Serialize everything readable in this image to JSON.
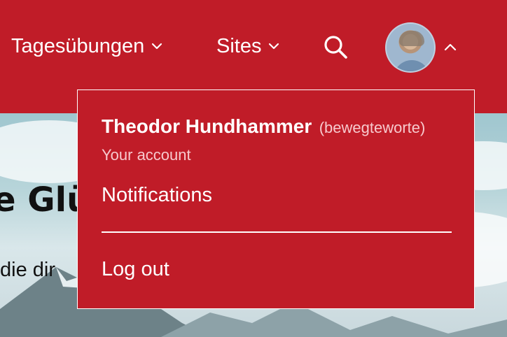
{
  "nav": {
    "items": [
      {
        "label": "Tagesübungen",
        "icon": "chevron-down-icon"
      },
      {
        "label": "Sites",
        "icon": "chevron-down-icon"
      }
    ],
    "search_icon": "search-icon",
    "avatar_toggle_icon": "chevron-up-icon"
  },
  "dropdown": {
    "user_name": "Theodor Hundhammer",
    "user_handle": "(bewegteworte)",
    "account_label": "Your account",
    "notifications_label": "Notifications",
    "logout_label": "Log out"
  },
  "background": {
    "heading_fragment": "e Glü",
    "text_fragment": "die dir"
  },
  "colors": {
    "brand_red": "#c01c28",
    "muted_text": "#f7c9cd"
  }
}
